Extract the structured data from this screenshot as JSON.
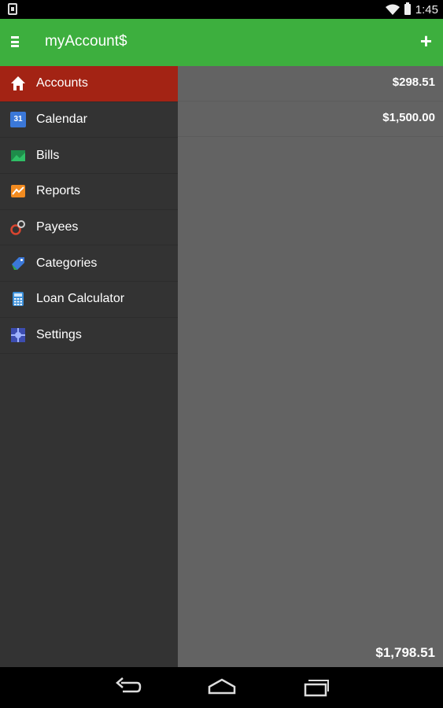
{
  "status_bar": {
    "time": "1:45"
  },
  "app": {
    "title": "myAccount$"
  },
  "drawer": {
    "items": [
      {
        "label": "Accounts"
      },
      {
        "label": "Calendar",
        "icon_text": "31"
      },
      {
        "label": "Bills"
      },
      {
        "label": "Reports"
      },
      {
        "label": "Payees"
      },
      {
        "label": "Categories"
      },
      {
        "label": "Loan Calculator"
      },
      {
        "label": "Settings"
      }
    ]
  },
  "accounts": {
    "rows": [
      {
        "amount": "$298.51"
      },
      {
        "amount": "$1,500.00"
      }
    ],
    "total": "$1,798.51"
  },
  "colors": {
    "action_bar": "#3daf3e",
    "drawer_active": "#a32314",
    "drawer_bg": "#333333",
    "content_bg": "#636363"
  }
}
